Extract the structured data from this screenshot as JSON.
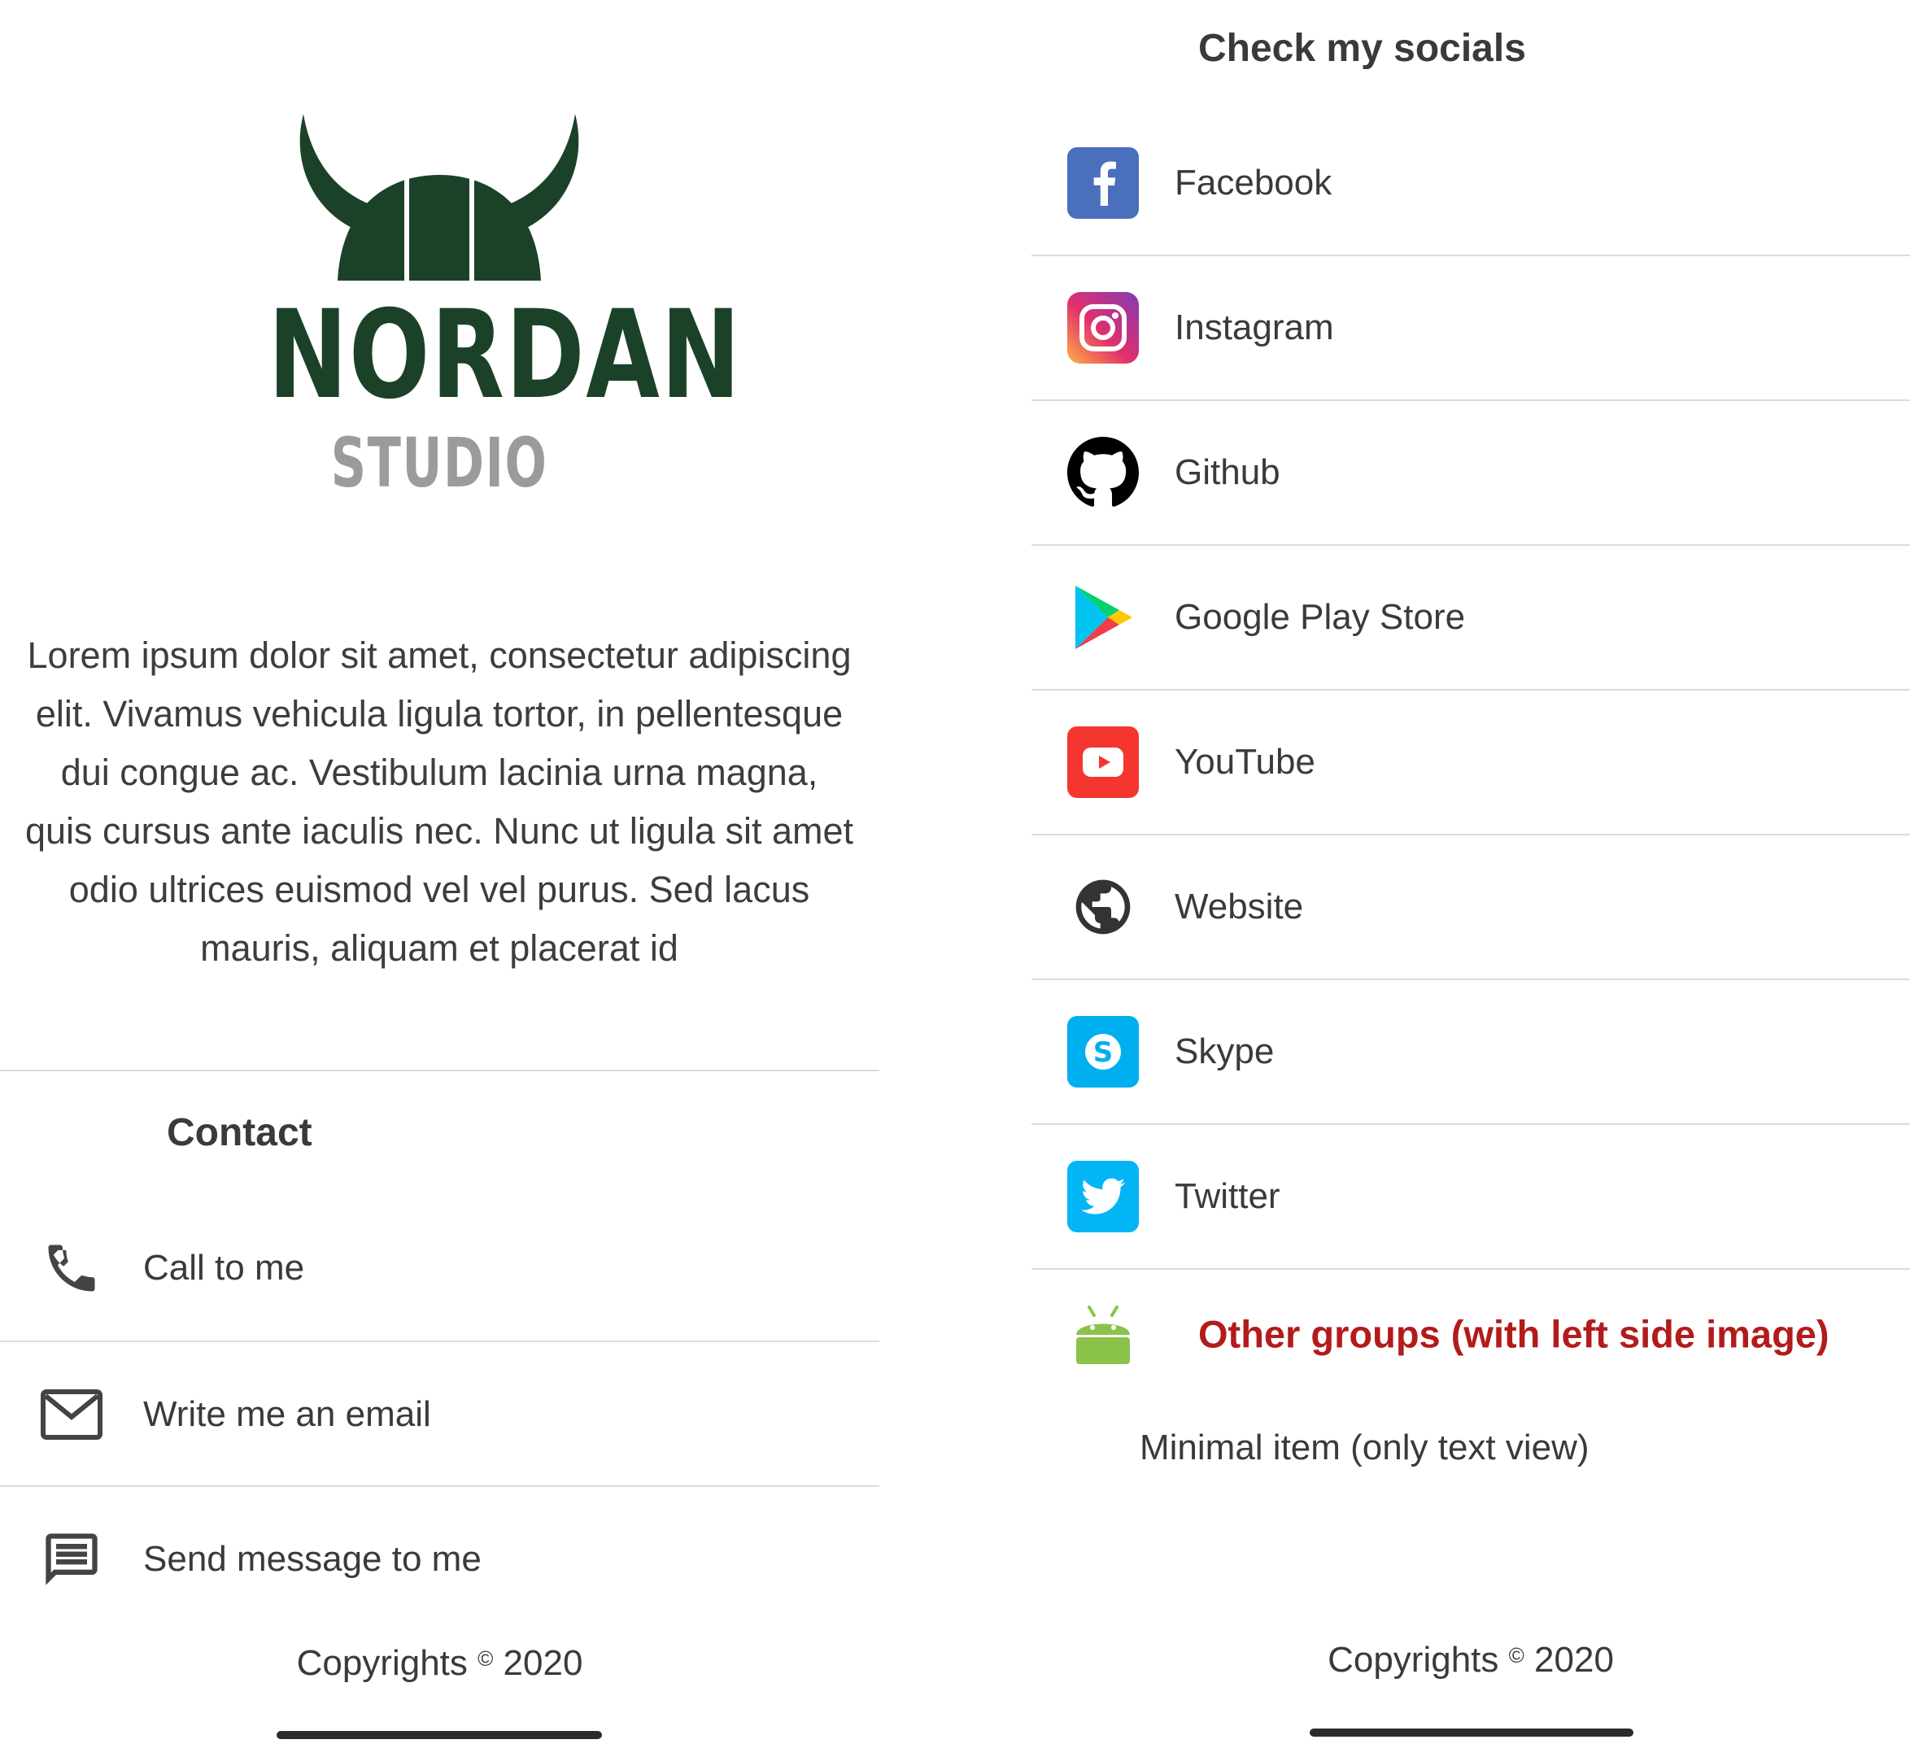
{
  "left": {
    "logo": {
      "main": "NORDAN",
      "sub": "STUDIO"
    },
    "intro_text": "Lorem ipsum dolor sit amet, consectetur adipiscing elit. Vivamus vehicula ligula tortor, in pellentesque dui congue ac. Vestibulum lacinia urna magna, quis cursus ante iaculis nec. Nunc ut ligula sit amet odio ultrices euismod vel vel purus. Sed lacus mauris, aliquam et placerat id",
    "contact": {
      "title": "Contact",
      "items": [
        {
          "label": "Call to me",
          "icon": "phone-icon"
        },
        {
          "label": "Write me an email",
          "icon": "email-icon"
        },
        {
          "label": "Send message to me",
          "icon": "message-icon"
        }
      ]
    },
    "copyright": {
      "text": "Copyrights",
      "symbol": "©",
      "year": "2020"
    }
  },
  "right": {
    "socials_title": "Check my socials",
    "socials": [
      {
        "label": "Facebook",
        "icon": "facebook-icon",
        "color": "#4a6fbd"
      },
      {
        "label": "Instagram",
        "icon": "instagram-icon",
        "color": "#c13584"
      },
      {
        "label": "Github",
        "icon": "github-icon",
        "color": "#000000"
      },
      {
        "label": "Google Play Store",
        "icon": "google-play-icon",
        "color": "#34a853"
      },
      {
        "label": "YouTube",
        "icon": "youtube-icon",
        "color": "#f5352f"
      },
      {
        "label": "Website",
        "icon": "globe-icon",
        "color": "#333333"
      },
      {
        "label": "Skype",
        "icon": "skype-icon",
        "color": "#00aff0"
      },
      {
        "label": "Twitter",
        "icon": "twitter-icon",
        "color": "#1da1f2"
      }
    ],
    "other_groups": {
      "label": "Other groups (with left side image)",
      "icon": "android-icon",
      "color": "#b31b1b",
      "icon_color": "#8bc34a"
    },
    "minimal_item": "Minimal item (only text view)",
    "copyright": {
      "text": "Copyrights",
      "symbol": "©",
      "year": "2020"
    }
  }
}
